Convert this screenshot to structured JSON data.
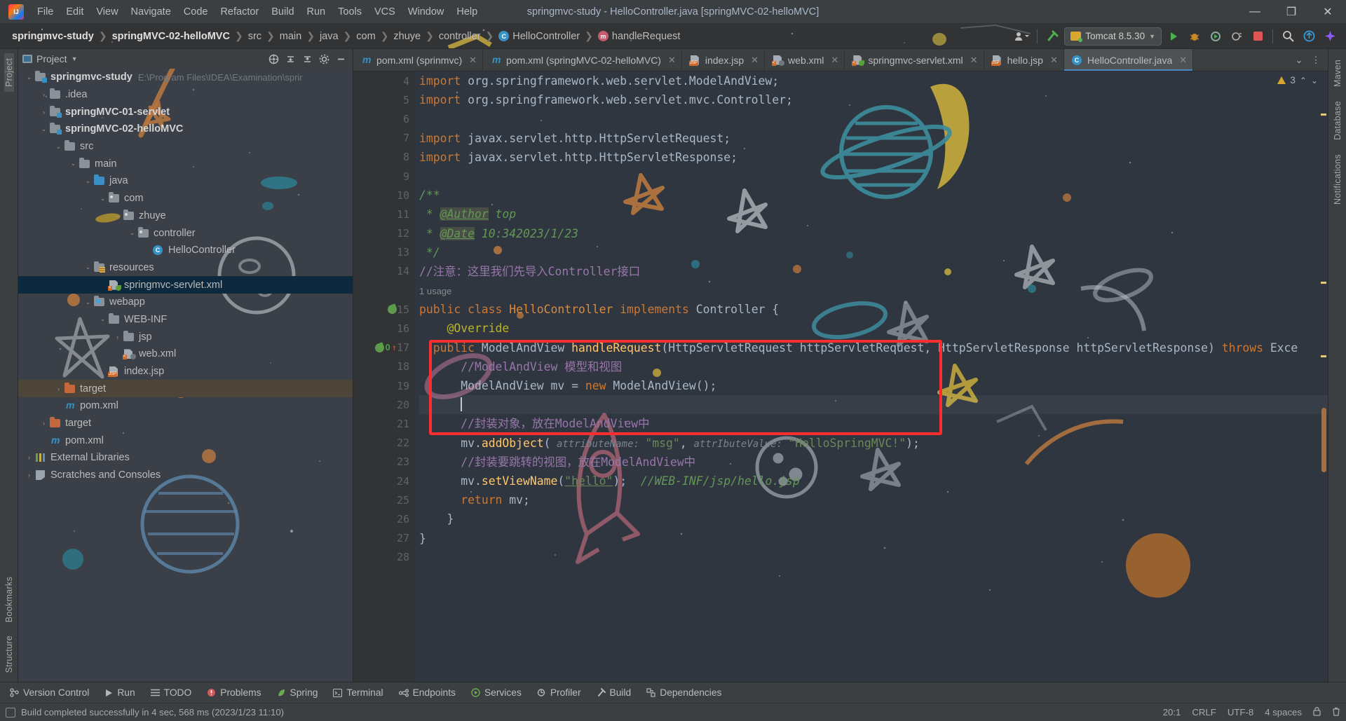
{
  "window": {
    "title": "springmvc-study - HelloController.java [springMVC-02-helloMVC]",
    "minimize": "—",
    "maximize": "❐",
    "close": "✕"
  },
  "menubar": {
    "logo_name": "intellij-idea-logo",
    "items": [
      "File",
      "Edit",
      "View",
      "Navigate",
      "Code",
      "Refactor",
      "Build",
      "Run",
      "Tools",
      "VCS",
      "Window",
      "Help"
    ]
  },
  "navbar": {
    "breadcrumbs": [
      {
        "label": "springmvc-study",
        "bold": true,
        "icon": ""
      },
      {
        "label": "springMVC-02-helloMVC",
        "bold": true,
        "icon": ""
      },
      {
        "label": "src",
        "bold": false,
        "icon": ""
      },
      {
        "label": "main",
        "bold": false,
        "icon": ""
      },
      {
        "label": "java",
        "bold": false,
        "icon": ""
      },
      {
        "label": "com",
        "bold": false,
        "icon": ""
      },
      {
        "label": "zhuye",
        "bold": false,
        "icon": ""
      },
      {
        "label": "controller",
        "bold": false,
        "icon": ""
      },
      {
        "label": "HelloController",
        "bold": false,
        "icon": "class-badge"
      },
      {
        "label": "handleRequest",
        "bold": false,
        "icon": "method-badge"
      }
    ],
    "separator": "❯",
    "run_config": "Tomcat 8.5.30",
    "class_badge_letter": "C",
    "method_badge_letter": "m"
  },
  "project_panel": {
    "title": "Project",
    "tree": [
      {
        "depth": 0,
        "arrow": "⌄",
        "label": "springmvc-study",
        "bold": true,
        "icon": "module-folder",
        "path": "E:\\Program Files\\IDEA\\Examination\\sprir"
      },
      {
        "depth": 1,
        "arrow": "›",
        "label": ".idea",
        "bold": false,
        "icon": "grey-folder",
        "path": ""
      },
      {
        "depth": 1,
        "arrow": "›",
        "label": "springMVC-01-servlet",
        "bold": true,
        "icon": "module-folder",
        "path": ""
      },
      {
        "depth": 1,
        "arrow": "⌄",
        "label": "springMVC-02-helloMVC",
        "bold": true,
        "icon": "module-folder",
        "path": ""
      },
      {
        "depth": 2,
        "arrow": "⌄",
        "label": "src",
        "bold": false,
        "icon": "grey-folder",
        "path": ""
      },
      {
        "depth": 3,
        "arrow": "⌄",
        "label": "main",
        "bold": false,
        "icon": "grey-folder",
        "path": ""
      },
      {
        "depth": 4,
        "arrow": "⌄",
        "label": "java",
        "bold": false,
        "icon": "source-folder",
        "path": ""
      },
      {
        "depth": 5,
        "arrow": "⌄",
        "label": "com",
        "bold": false,
        "icon": "package",
        "path": ""
      },
      {
        "depth": 6,
        "arrow": "⌄",
        "label": "zhuye",
        "bold": false,
        "icon": "package",
        "path": ""
      },
      {
        "depth": 7,
        "arrow": "⌄",
        "label": "controller",
        "bold": false,
        "icon": "package",
        "path": ""
      },
      {
        "depth": 8,
        "arrow": "",
        "label": "HelloController",
        "bold": false,
        "icon": "java-class",
        "path": ""
      },
      {
        "depth": 4,
        "arrow": "⌄",
        "label": "resources",
        "bold": false,
        "icon": "resources-folder",
        "path": ""
      },
      {
        "depth": 5,
        "arrow": "",
        "label": "springmvc-servlet.xml",
        "bold": false,
        "icon": "xml-spring",
        "path": "",
        "selected": true
      },
      {
        "depth": 4,
        "arrow": "⌄",
        "label": "webapp",
        "bold": false,
        "icon": "web-folder",
        "path": ""
      },
      {
        "depth": 5,
        "arrow": "⌄",
        "label": "WEB-INF",
        "bold": false,
        "icon": "grey-folder",
        "path": ""
      },
      {
        "depth": 6,
        "arrow": "›",
        "label": "jsp",
        "bold": false,
        "icon": "grey-folder",
        "path": ""
      },
      {
        "depth": 6,
        "arrow": "",
        "label": "web.xml",
        "bold": false,
        "icon": "xml-web",
        "path": ""
      },
      {
        "depth": 5,
        "arrow": "",
        "label": "index.jsp",
        "bold": false,
        "icon": "jsp-file",
        "path": ""
      },
      {
        "depth": 2,
        "arrow": "›",
        "label": "target",
        "bold": false,
        "icon": "orange-folder",
        "path": "",
        "highlight": true
      },
      {
        "depth": 2,
        "arrow": "",
        "label": "pom.xml",
        "bold": false,
        "icon": "maven-file",
        "path": ""
      },
      {
        "depth": 1,
        "arrow": "›",
        "label": "target",
        "bold": false,
        "icon": "orange-folder",
        "path": ""
      },
      {
        "depth": 1,
        "arrow": "",
        "label": "pom.xml",
        "bold": false,
        "icon": "maven-file",
        "path": ""
      },
      {
        "depth": 0,
        "arrow": "›",
        "label": "External Libraries",
        "bold": false,
        "icon": "libraries",
        "path": ""
      },
      {
        "depth": 0,
        "arrow": "›",
        "label": "Scratches and Consoles",
        "bold": false,
        "icon": "scratches",
        "path": ""
      }
    ]
  },
  "left_rail": {
    "top": [
      "Project"
    ],
    "bottom": [
      "Bookmarks",
      "Structure"
    ]
  },
  "right_rail": {
    "items": [
      "Maven",
      "Database",
      "Notifications"
    ]
  },
  "editor_tabs": {
    "tabs": [
      {
        "label": "pom.xml (sprinmvc)",
        "icon": "maven-file",
        "active": false,
        "close": "✕"
      },
      {
        "label": "pom.xml (springMVC-02-helloMVC)",
        "icon": "maven-file",
        "active": false,
        "close": "✕"
      },
      {
        "label": "index.jsp",
        "icon": "jsp-file",
        "active": false,
        "close": "✕"
      },
      {
        "label": "web.xml",
        "icon": "xml-web",
        "active": false,
        "close": "✕"
      },
      {
        "label": "springmvc-servlet.xml",
        "icon": "xml-spring",
        "active": false,
        "close": "✕"
      },
      {
        "label": "hello.jsp",
        "icon": "jsp-file",
        "active": false,
        "close": "✕"
      },
      {
        "label": "HelloController.java",
        "icon": "java-class",
        "active": true,
        "close": "✕"
      }
    ]
  },
  "inspection": {
    "warning_count": "3",
    "up": "⌃",
    "down": "⌄"
  },
  "code": {
    "first_line_number": 4,
    "lines": [
      {
        "n": 4,
        "fold": "⊟"
      },
      {
        "n": 5,
        "fold": ""
      },
      {
        "n": 6,
        "fold": ""
      },
      {
        "n": 7,
        "fold": ""
      },
      {
        "n": 8,
        "fold": "⊟"
      },
      {
        "n": 9,
        "fold": ""
      },
      {
        "n": 10,
        "fold": "⊟"
      },
      {
        "n": 11,
        "fold": ""
      },
      {
        "n": 12,
        "fold": ""
      },
      {
        "n": 13,
        "fold": "⊟"
      },
      {
        "n": 14,
        "fold": ""
      },
      {
        "n": "",
        "fold": ""
      },
      {
        "n": 15,
        "fold": "",
        "mark": "bean"
      },
      {
        "n": 16,
        "fold": ""
      },
      {
        "n": 17,
        "fold": "⊟",
        "mark": "override"
      },
      {
        "n": 18,
        "fold": ""
      },
      {
        "n": 19,
        "fold": ""
      },
      {
        "n": 20,
        "fold": ""
      },
      {
        "n": 21,
        "fold": ""
      },
      {
        "n": 22,
        "fold": ""
      },
      {
        "n": 23,
        "fold": ""
      },
      {
        "n": 24,
        "fold": ""
      },
      {
        "n": 25,
        "fold": ""
      },
      {
        "n": 26,
        "fold": ""
      },
      {
        "n": 27,
        "fold": ""
      },
      {
        "n": 28,
        "fold": ""
      }
    ],
    "text": {
      "l4": "import org.springframework.web.servlet.ModelAndView;",
      "l5": "import org.springframework.web.servlet.mvc.Controller;",
      "l7": "import javax.servlet.http.HttpServletRequest;",
      "l8": "import javax.servlet.http.HttpServletResponse;",
      "l10": "/**",
      "l11_star": " * ",
      "l11_tag": "@Author",
      "l11_val": " top",
      "l12_star": " * ",
      "l12_tag": "@Date",
      "l12_val": " 10:342023/1/23",
      "l13": " */",
      "l14": "//注意：这里我们先导入Controller接口",
      "usage": "1 usage",
      "l15_kw1": "public class ",
      "l15_cls": "HelloController ",
      "l15_kw2": "implements ",
      "l15_iface": "Controller {",
      "l16": "@Override",
      "l17_kw": "public ",
      "l17_rest": "ModelAndView ",
      "l17_fn": "handleRequest",
      "l17_args": "(HttpServletRequest httpServletRequest, HttpServletResponse httpServletResponse) ",
      "l17_throws": "throws ",
      "l17_exc": "Exce",
      "l18": "//ModelAndView 模型和视图",
      "l19_a": "ModelAndView mv = ",
      "l19_kw": "new ",
      "l19_b": "ModelAndView();",
      "l21": "//封装对象，放在ModelAndView中",
      "l22_a": "mv.",
      "l22_fn": "addObject",
      "l22_p1": "( attributeName: ",
      "l22_s1": "\"msg\"",
      "l22_p2": ", attributeValue: ",
      "l22_s2": "\"HelloSpringMVC!\"",
      "l22_end": ");",
      "l23": "//封装要跳转的视图，放在ModelAndView中",
      "l24_a": "mv.",
      "l24_fn": "setViewName",
      "l24_p": "(",
      "l24_s": "\"hello\"",
      "l24_end": ");  ",
      "l24_cmt": "//WEB-INF/jsp/hello.jsp",
      "l25_kw": "return ",
      "l25_rest": "mv;",
      "l26": "}",
      "l27": "}"
    }
  },
  "bottom_bar": {
    "items": [
      {
        "label": "Version Control",
        "icon": "branch-icon"
      },
      {
        "label": "Run",
        "icon": "play-icon"
      },
      {
        "label": "TODO",
        "icon": "list-icon"
      },
      {
        "label": "Problems",
        "icon": "error-icon"
      },
      {
        "label": "Spring",
        "icon": "leaf-icon"
      },
      {
        "label": "Terminal",
        "icon": "terminal-icon"
      },
      {
        "label": "Endpoints",
        "icon": "endpoints-icon"
      },
      {
        "label": "Services",
        "icon": "services-icon"
      },
      {
        "label": "Profiler",
        "icon": "profiler-icon"
      },
      {
        "label": "Build",
        "icon": "hammer-icon"
      },
      {
        "label": "Dependencies",
        "icon": "dependencies-icon"
      }
    ]
  },
  "status_bar": {
    "message": "Build completed successfully in 4 sec, 568 ms (2023/1/23 11:10)",
    "caret_position": "20:1",
    "line_separator": "CRLF",
    "encoding": "UTF-8",
    "indent": "4 spaces"
  },
  "colors": {
    "accent": "#4a88c7",
    "selection": "#0d293e",
    "red_box": "#ff2d2d",
    "editor_bg": "#2f3640",
    "panel_bg": "#3c3f41",
    "tomcat_green": "#5bb75b"
  }
}
